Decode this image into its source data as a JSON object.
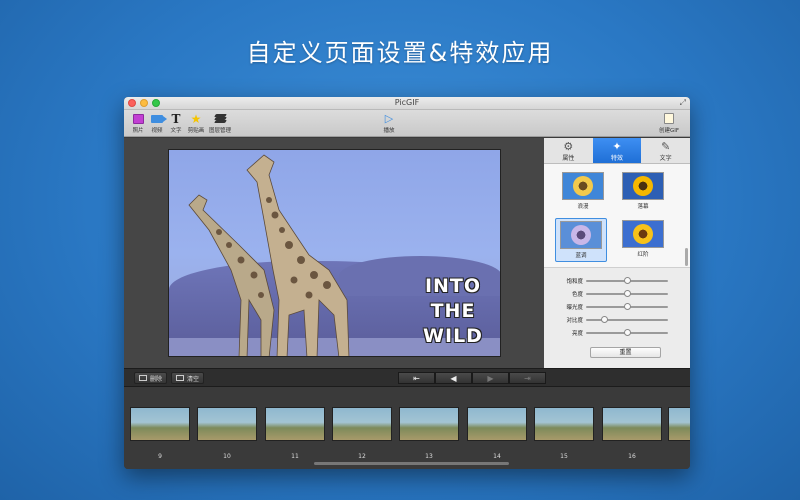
{
  "headline": "自定义页面设置&特效应用",
  "window": {
    "title": "PicGIF"
  },
  "toolbar": {
    "items": [
      {
        "label": "照片",
        "icon": "photo-icon"
      },
      {
        "label": "视频",
        "icon": "video-icon"
      },
      {
        "label": "文字",
        "icon": "text-icon"
      },
      {
        "label": "剪贴画",
        "icon": "star-icon"
      },
      {
        "label": "图层管理",
        "icon": "layers-icon"
      }
    ],
    "play_label": "播放",
    "create_label": "创建GIF"
  },
  "preview": {
    "overlay_text": "INTO\nTHE\nWILD"
  },
  "side_panel": {
    "tabs": [
      {
        "label": "属性",
        "icon": "gear-icon",
        "active": false
      },
      {
        "label": "特效",
        "icon": "magic-wand-icon",
        "active": true
      },
      {
        "label": "文字",
        "icon": "edit-icon",
        "active": false
      }
    ],
    "effects": [
      {
        "label": "浪漫",
        "selected": false
      },
      {
        "label": "落幕",
        "selected": false
      },
      {
        "label": "蓝调",
        "selected": true
      },
      {
        "label": "红阶",
        "selected": false
      }
    ],
    "sliders": [
      {
        "label": "饱和度",
        "value": 0.5
      },
      {
        "label": "色度",
        "value": 0.5
      },
      {
        "label": "曝光度",
        "value": 0.5
      },
      {
        "label": "对比度",
        "value": 0.22
      },
      {
        "label": "亮度",
        "value": 0.5
      }
    ],
    "reset_label": "重置"
  },
  "controls": {
    "delete_label": "删除",
    "clear_label": "清空"
  },
  "filmstrip": {
    "frames": [
      "9",
      "10",
      "11",
      "12",
      "13",
      "14",
      "15",
      "16"
    ]
  },
  "colors": {
    "background": "#2a78c4",
    "accent": "#1f6fd6",
    "tint_overlay": "#8fa6e8"
  }
}
